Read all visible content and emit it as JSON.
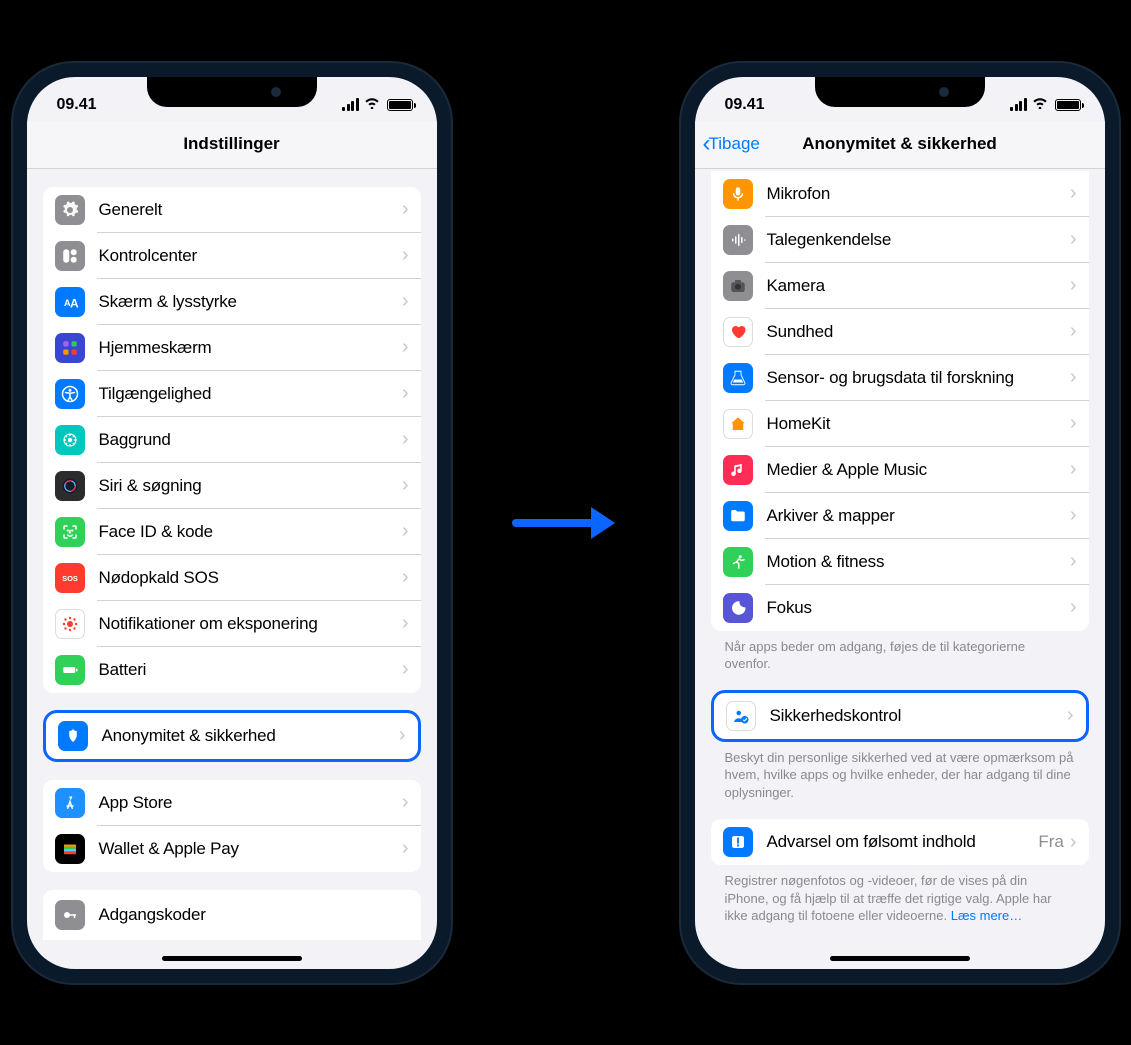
{
  "status": {
    "time": "09.41"
  },
  "phone1": {
    "title": "Indstillinger",
    "group1": [
      {
        "icon": "gear-icon",
        "label": "Generelt",
        "bg": "#8e8e93"
      },
      {
        "icon": "control-center-icon",
        "label": "Kontrolcenter",
        "bg": "#8e8e93"
      },
      {
        "icon": "display-icon",
        "label": "Skærm & lysstyrke",
        "bg": "#007aff"
      },
      {
        "icon": "home-screen-icon",
        "label": "Hjemmeskærm",
        "bg": "#3946d3"
      },
      {
        "icon": "accessibility-icon",
        "label": "Tilgængelighed",
        "bg": "#007aff"
      },
      {
        "icon": "wallpaper-icon",
        "label": "Baggrund",
        "bg": "#00c7be"
      },
      {
        "icon": "siri-icon",
        "label": "Siri & søgning",
        "bg": "#2c2c2e"
      },
      {
        "icon": "faceid-icon",
        "label": "Face ID & kode",
        "bg": "#30d158"
      },
      {
        "icon": "sos-icon",
        "label": "Nødopkald SOS",
        "bg": "#ff3b30"
      },
      {
        "icon": "exposure-icon",
        "label": "Notifikationer om eksponering",
        "bg": "#ffffff"
      },
      {
        "icon": "battery-icon",
        "label": "Batteri",
        "bg": "#30d158"
      }
    ],
    "highlight": {
      "icon": "privacy-icon",
      "label": "Anonymitet & sikkerhed",
      "bg": "#007aff"
    },
    "group2": [
      {
        "icon": "appstore-icon",
        "label": "App Store",
        "bg": "#1e90ff"
      },
      {
        "icon": "wallet-icon",
        "label": "Wallet & Apple Pay",
        "bg": "#000000"
      }
    ],
    "group3": [
      {
        "icon": "passwords-icon",
        "label": "Adgangskoder",
        "bg": "#8e8e93"
      }
    ]
  },
  "phone2": {
    "back": "Tibage",
    "title": "Anonymitet & sikkerhed",
    "group1": [
      {
        "icon": "microphone-icon",
        "label": "Mikrofon",
        "bg": "#ff9500"
      },
      {
        "icon": "speech-icon",
        "label": "Talegenkendelse",
        "bg": "#8e8e93"
      },
      {
        "icon": "camera-icon",
        "label": "Kamera",
        "bg": "#8e8e93"
      },
      {
        "icon": "health-icon",
        "label": "Sundhed",
        "bg": "#ffffff"
      },
      {
        "icon": "research-icon",
        "label": "Sensor- og brugsdata til forskning",
        "bg": "#007aff"
      },
      {
        "icon": "homekit-icon",
        "label": "HomeKit",
        "bg": "#ffffff"
      },
      {
        "icon": "music-icon",
        "label": "Medier & Apple Music",
        "bg": "#ff2d55"
      },
      {
        "icon": "files-icon",
        "label": "Arkiver & mapper",
        "bg": "#007aff"
      },
      {
        "icon": "fitness-icon",
        "label": "Motion & fitness",
        "bg": "#30d158"
      },
      {
        "icon": "focus-icon",
        "label": "Fokus",
        "bg": "#5856d6"
      }
    ],
    "footer1": "Når apps beder om adgang, føjes de til kategorierne ovenfor.",
    "highlight": {
      "icon": "safety-check-icon",
      "label": "Sikkerhedskontrol",
      "bg": "#ffffff"
    },
    "footer2": "Beskyt din personlige sikkerhed ved at være opmærksom på hvem, hvilke apps og hvilke enheder, der har adgang til dine oplysninger.",
    "group3": [
      {
        "icon": "sensitive-content-icon",
        "label": "Advarsel om følsomt indhold",
        "value": "Fra",
        "bg": "#007aff"
      }
    ],
    "footer3_a": "Registrer nøgenfotos og -videoer, før de vises på din iPhone, og få hjælp til at træffe det rigtige valg. Apple har ikke adgang til fotoene eller videoerne. ",
    "footer3_link": "Læs mere…"
  }
}
